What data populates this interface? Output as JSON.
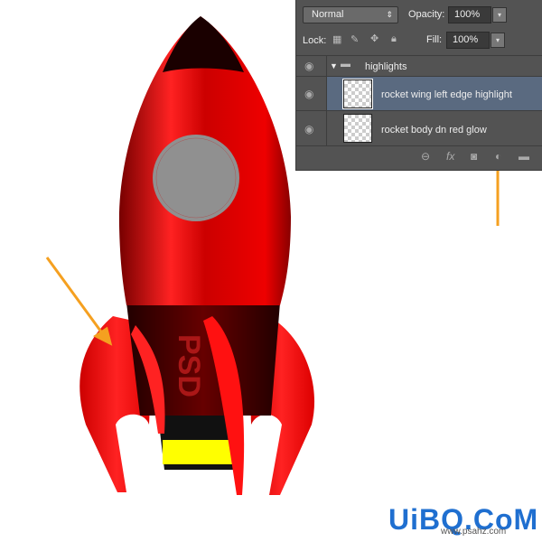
{
  "colors": {
    "rocket_red": "#e00000",
    "arrow": "#f5a020",
    "panel_bg": "#535353",
    "selected_row": "#5a6a80"
  },
  "artwork": {
    "body_text": "PSD"
  },
  "layers_panel": {
    "blend_mode": "Normal",
    "opacity_label": "Opacity:",
    "opacity": "100%",
    "lock_label": "Lock:",
    "fill_label": "Fill:",
    "fill": "100%",
    "group": {
      "name": "highlights",
      "expanded": true
    },
    "layers": [
      {
        "name": "rocket wing left edge highlight",
        "selected": true,
        "visible": true
      },
      {
        "name": "rocket body dn red glow",
        "selected": false,
        "visible": true
      }
    ],
    "icons": [
      "link-icon",
      "fx-icon",
      "mask-icon",
      "adjustment-icon",
      "folder-icon"
    ]
  },
  "watermark": {
    "logo": "UiBQ.CoM",
    "url": "www.psahz.com"
  }
}
